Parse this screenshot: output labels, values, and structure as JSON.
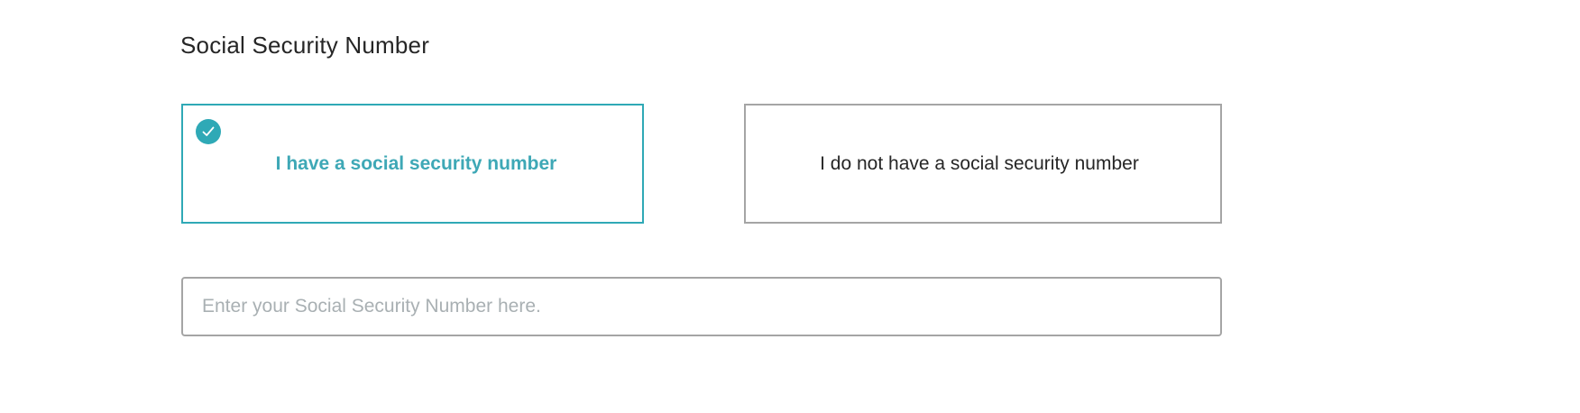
{
  "section": {
    "title": "Social Security Number"
  },
  "options": [
    {
      "label": "I have a social security number",
      "selected": true
    },
    {
      "label": "I do not have a social security number",
      "selected": false
    }
  ],
  "ssn_field": {
    "value": "",
    "placeholder": "Enter your Social Security Number here."
  },
  "colors": {
    "accent": "#2fa9b6",
    "border": "#a5a5a5",
    "placeholder": "#a9b0b3"
  },
  "icons": {
    "selected_marker": "checkmark-circle-icon"
  }
}
